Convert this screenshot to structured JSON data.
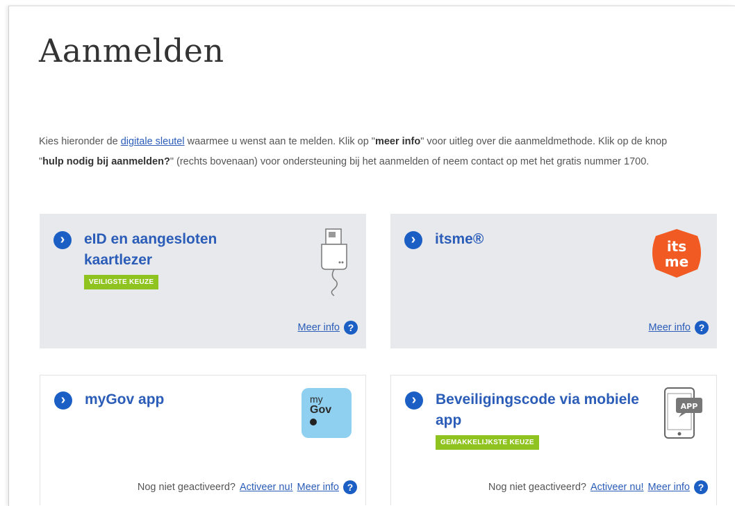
{
  "page": {
    "title": "Aanmelden",
    "intro": {
      "part1": "Kies hieronder de ",
      "link": "digitale sleutel",
      "part2": " waarmee u wenst aan te melden. Klik op \"",
      "bold1": "meer info",
      "part3": "\" voor uitleg over die aanmeldmethode. Klik op de knop \"",
      "bold2": "hulp nodig bij aanmelden?",
      "part4": "\" (rechts bovenaan) voor ondersteuning bij het aanmelden of neem contact op met het gratis nummer 1700."
    }
  },
  "cards": {
    "eid": {
      "title_line1": "eID en aangesloten",
      "title_line2": "kaartlezer",
      "badge": "VEILIGSTE KEUZE",
      "meer_info": "Meer info",
      "help_glyph": "?"
    },
    "itsme": {
      "title": "itsme®",
      "logo_line1": "its",
      "logo_line2": "me",
      "meer_info": "Meer info",
      "help_glyph": "?"
    },
    "mygov": {
      "title": "myGov app",
      "logo_line1": "my",
      "logo_line2": "Gov",
      "not_active": "Nog niet geactiveerd?",
      "activate": "Activeer nu!",
      "meer_info": "Meer info",
      "help_glyph": "?"
    },
    "code": {
      "title_line1": "Beveiligingscode via mobiele",
      "title_line2": "app",
      "badge": "GEMAKKELIJKSTE KEUZE",
      "logo_label": "APP",
      "not_active": "Nog niet geactiveerd?",
      "activate": "Activeer nu!",
      "meer_info": "Meer info",
      "help_glyph": "?"
    }
  },
  "icons": [
    "chevron-right-icon",
    "help-circle-icon",
    "card-reader-icon",
    "itsme-logo",
    "mygov-logo",
    "phone-app-icon"
  ],
  "colors": {
    "link_blue": "#2a5cb8",
    "icon_blue": "#1c5fc4",
    "badge_green": "#8fc31f",
    "card_grey": "#e7e9ec",
    "itsme_orange": "#f15a22"
  }
}
